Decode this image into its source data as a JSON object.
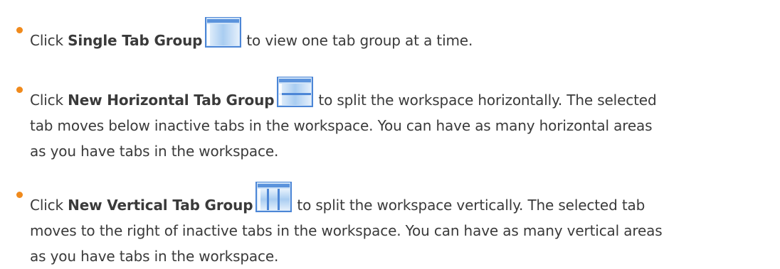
{
  "items": [
    {
      "prefix": "Click ",
      "command": "Single Tab Group",
      "icon": "single-tab-group-icon",
      "after_icon": "to view one tab group at a time."
    },
    {
      "prefix": "Click ",
      "command": "New Horizontal Tab Group",
      "icon": "new-horizontal-tab-group-icon",
      "after_icon": "to split the workspace horizontally. The selected",
      "line2": "tab moves below inactive tabs in the workspace. You can have as many horizontal areas",
      "line3": "as you have tabs in the workspace."
    },
    {
      "prefix": "Click ",
      "command": "New Vertical Tab Group",
      "icon": "new-vertical-tab-group-icon",
      "after_icon": "to split the workspace vertically. The selected tab",
      "line2": "moves to the right of inactive tabs in the workspace. You can have as many vertical areas",
      "line3": "as you have tabs in the workspace."
    }
  ],
  "colors": {
    "bullet": "#f08a1c",
    "icon_border": "#4c86d6",
    "icon_fill": "#cfe3f8"
  }
}
